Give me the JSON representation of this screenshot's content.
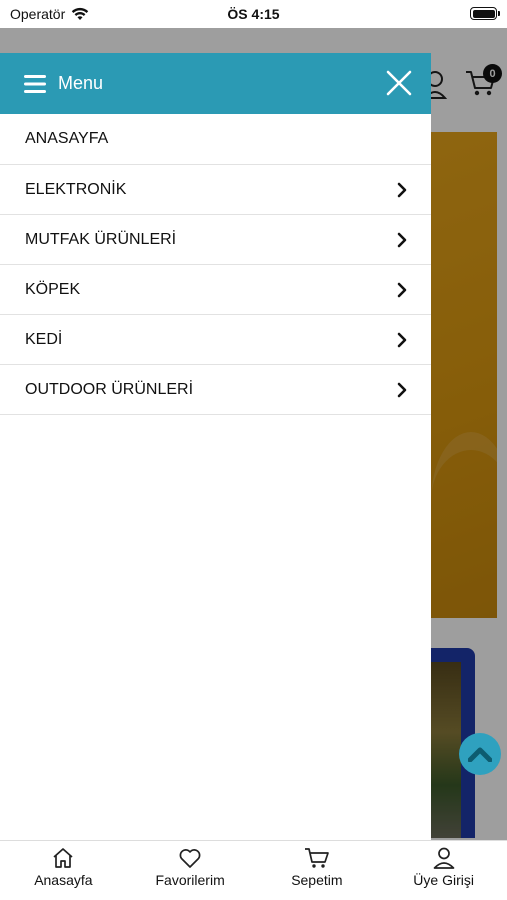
{
  "status_bar": {
    "carrier": "Operatör",
    "time": "ÖS 4:15"
  },
  "background_page": {
    "cart_count": "0"
  },
  "drawer": {
    "title": "Menu",
    "items": [
      {
        "label": "ANASAYFA",
        "has_submenu": false
      },
      {
        "label": "ELEKTRONİK",
        "has_submenu": true
      },
      {
        "label": "MUTFAK ÜRÜNLERİ",
        "has_submenu": true
      },
      {
        "label": "KÖPEK",
        "has_submenu": true
      },
      {
        "label": "KEDİ",
        "has_submenu": true
      },
      {
        "label": "OUTDOOR ÜRÜNLERİ",
        "has_submenu": true
      }
    ]
  },
  "tab_bar": {
    "tabs": [
      {
        "label": "Anasayfa",
        "icon": "home-icon"
      },
      {
        "label": "Favorilerim",
        "icon": "heart-icon"
      },
      {
        "label": "Sepetim",
        "icon": "cart-icon"
      },
      {
        "label": "Üye Girişi",
        "icon": "user-icon"
      }
    ]
  },
  "colors": {
    "accent": "#2b9ab4",
    "scroll_button": "#2fa1bf",
    "banner": "#e0a018"
  }
}
